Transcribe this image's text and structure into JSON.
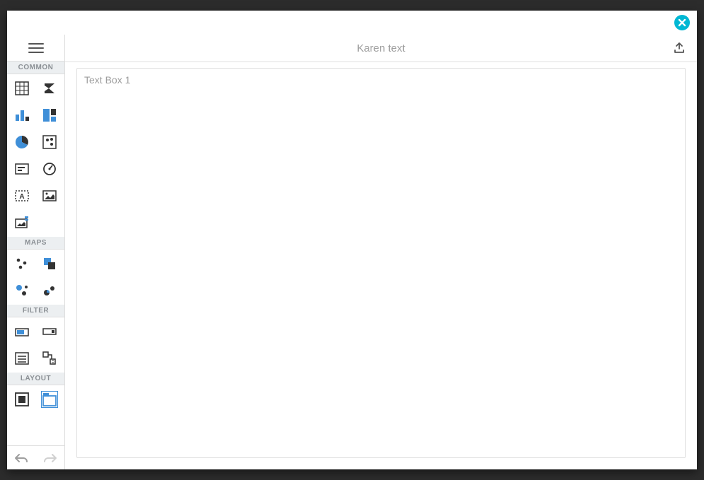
{
  "header": {
    "title": "Karen text"
  },
  "sidebar": {
    "groups": {
      "common": "COMMON",
      "maps": "MAPS",
      "filter": "FILTER",
      "layout": "LAYOUT"
    }
  },
  "canvas": {
    "textbox1": "Text Box 1"
  },
  "icons": {
    "close": "close",
    "menu": "menu",
    "export": "export",
    "undo": "undo",
    "redo": "redo",
    "grid": "grid",
    "pivot": "pivot",
    "chart": "chart",
    "treemap": "treemap",
    "pie": "pie",
    "scatter": "scatter",
    "card": "card",
    "gauge": "gauge",
    "textbox": "textbox",
    "image": "image",
    "boundimage": "boundimage",
    "geopoint": "geopoint",
    "choropleth": "choropleth",
    "bubble": "bubble",
    "piemap": "piemap",
    "range": "range",
    "combobox": "combobox",
    "listbox": "listbox",
    "treeview": "treeview",
    "group": "group",
    "tabcontainer": "tabcontainer"
  }
}
